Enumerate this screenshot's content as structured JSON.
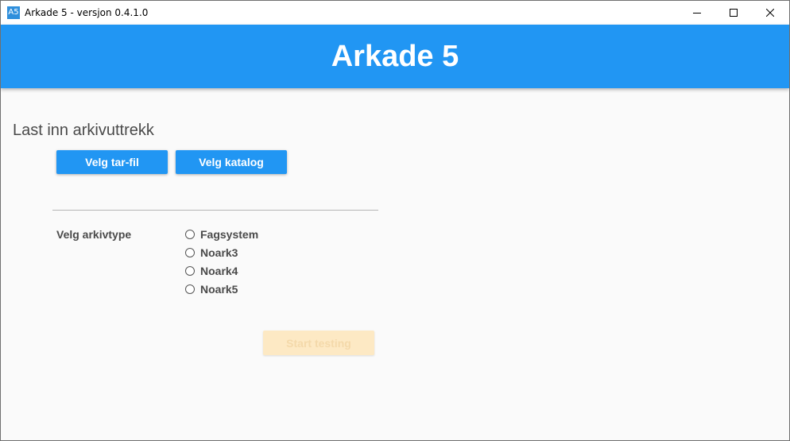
{
  "window": {
    "icon_text": "A5",
    "title": "Arkade 5 - versjon 0.4.1.0",
    "controls": [
      "minimize-icon",
      "maximize-icon",
      "close-icon"
    ]
  },
  "header": {
    "title": "Arkade 5"
  },
  "load": {
    "section_title": "Last inn arkivuttrekk",
    "tar_button": "Velg tar-fil",
    "dir_button": "Velg katalog"
  },
  "archive_type": {
    "label": "Velg arkivtype",
    "options": [
      {
        "label": "Fagsystem",
        "selected": false
      },
      {
        "label": "Noark3",
        "selected": false
      },
      {
        "label": "Noark4",
        "selected": false
      },
      {
        "label": "Noark5",
        "selected": false
      }
    ]
  },
  "actions": {
    "start_button": "Start testing",
    "start_enabled": false
  },
  "colors": {
    "primary": "#2196f3",
    "disabled_button_bg": "#fde9c4",
    "disabled_button_text": "#f4d9aa",
    "background": "#fafafa"
  }
}
